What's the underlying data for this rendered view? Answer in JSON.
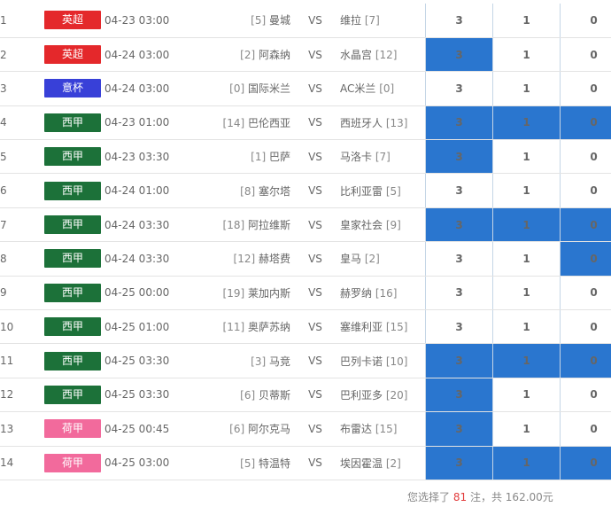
{
  "colors": {
    "selected_bg": "#2a76cf",
    "英超": "#e4282b",
    "意杯": "#3840d8",
    "西甲": "#1c7139",
    "荷甲": "#f26a9c",
    "highlight": "#e23c3c"
  },
  "rows": [
    {
      "num": "1",
      "league": "英超",
      "time": "04-23 03:00",
      "home_rank": "[5]",
      "home": "曼城",
      "vs": "VS",
      "away": "维拉",
      "away_rank": "[7]",
      "odds": [
        {
          "label": "3",
          "selected": false
        },
        {
          "label": "1",
          "selected": false
        },
        {
          "label": "0",
          "selected": false
        }
      ]
    },
    {
      "num": "2",
      "league": "英超",
      "time": "04-24 03:00",
      "home_rank": "[2]",
      "home": "阿森纳",
      "vs": "VS",
      "away": "水晶宫",
      "away_rank": "[12]",
      "odds": [
        {
          "label": "3",
          "selected": true
        },
        {
          "label": "1",
          "selected": false
        },
        {
          "label": "0",
          "selected": false
        }
      ]
    },
    {
      "num": "3",
      "league": "意杯",
      "time": "04-24 03:00",
      "home_rank": "[0]",
      "home": "国际米兰",
      "vs": "VS",
      "away": "AC米兰",
      "away_rank": "[0]",
      "odds": [
        {
          "label": "3",
          "selected": false
        },
        {
          "label": "1",
          "selected": false
        },
        {
          "label": "0",
          "selected": false
        }
      ]
    },
    {
      "num": "4",
      "league": "西甲",
      "time": "04-23 01:00",
      "home_rank": "[14]",
      "home": "巴伦西亚",
      "vs": "VS",
      "away": "西班牙人",
      "away_rank": "[13]",
      "odds": [
        {
          "label": "3",
          "selected": true
        },
        {
          "label": "1",
          "selected": true
        },
        {
          "label": "0",
          "selected": true
        }
      ]
    },
    {
      "num": "5",
      "league": "西甲",
      "time": "04-23 03:30",
      "home_rank": "[1]",
      "home": "巴萨",
      "vs": "VS",
      "away": "马洛卡",
      "away_rank": "[7]",
      "odds": [
        {
          "label": "3",
          "selected": true
        },
        {
          "label": "1",
          "selected": false
        },
        {
          "label": "0",
          "selected": false
        }
      ]
    },
    {
      "num": "6",
      "league": "西甲",
      "time": "04-24 01:00",
      "home_rank": "[8]",
      "home": "塞尔塔",
      "vs": "VS",
      "away": "比利亚雷",
      "away_rank": "[5]",
      "odds": [
        {
          "label": "3",
          "selected": false
        },
        {
          "label": "1",
          "selected": false
        },
        {
          "label": "0",
          "selected": false
        }
      ]
    },
    {
      "num": "7",
      "league": "西甲",
      "time": "04-24 03:30",
      "home_rank": "[18]",
      "home": "阿拉维斯",
      "vs": "VS",
      "away": "皇家社会",
      "away_rank": "[9]",
      "odds": [
        {
          "label": "3",
          "selected": true
        },
        {
          "label": "1",
          "selected": true
        },
        {
          "label": "0",
          "selected": true
        }
      ]
    },
    {
      "num": "8",
      "league": "西甲",
      "time": "04-24 03:30",
      "home_rank": "[12]",
      "home": "赫塔费",
      "vs": "VS",
      "away": "皇马",
      "away_rank": "[2]",
      "odds": [
        {
          "label": "3",
          "selected": false
        },
        {
          "label": "1",
          "selected": false
        },
        {
          "label": "0",
          "selected": true
        }
      ]
    },
    {
      "num": "9",
      "league": "西甲",
      "time": "04-25 00:00",
      "home_rank": "[19]",
      "home": "莱加内斯",
      "vs": "VS",
      "away": "赫罗纳",
      "away_rank": "[16]",
      "odds": [
        {
          "label": "3",
          "selected": false
        },
        {
          "label": "1",
          "selected": false
        },
        {
          "label": "0",
          "selected": false
        }
      ]
    },
    {
      "num": "10",
      "league": "西甲",
      "time": "04-25 01:00",
      "home_rank": "[11]",
      "home": "奥萨苏纳",
      "vs": "VS",
      "away": "塞维利亚",
      "away_rank": "[15]",
      "odds": [
        {
          "label": "3",
          "selected": false
        },
        {
          "label": "1",
          "selected": false
        },
        {
          "label": "0",
          "selected": false
        }
      ]
    },
    {
      "num": "11",
      "league": "西甲",
      "time": "04-25 03:30",
      "home_rank": "[3]",
      "home": "马竞",
      "vs": "VS",
      "away": "巴列卡诺",
      "away_rank": "[10]",
      "odds": [
        {
          "label": "3",
          "selected": true
        },
        {
          "label": "1",
          "selected": true
        },
        {
          "label": "0",
          "selected": true
        }
      ]
    },
    {
      "num": "12",
      "league": "西甲",
      "time": "04-25 03:30",
      "home_rank": "[6]",
      "home": "贝蒂斯",
      "vs": "VS",
      "away": "巴利亚多",
      "away_rank": "[20]",
      "odds": [
        {
          "label": "3",
          "selected": true
        },
        {
          "label": "1",
          "selected": false
        },
        {
          "label": "0",
          "selected": false
        }
      ]
    },
    {
      "num": "13",
      "league": "荷甲",
      "time": "04-25 00:45",
      "home_rank": "[6]",
      "home": "阿尔克马",
      "vs": "VS",
      "away": "布雷达",
      "away_rank": "[15]",
      "odds": [
        {
          "label": "3",
          "selected": true
        },
        {
          "label": "1",
          "selected": false
        },
        {
          "label": "0",
          "selected": false
        }
      ]
    },
    {
      "num": "14",
      "league": "荷甲",
      "time": "04-25 03:00",
      "home_rank": "[5]",
      "home": "特温特",
      "vs": "VS",
      "away": "埃因霍温",
      "away_rank": "[2]",
      "odds": [
        {
          "label": "3",
          "selected": true
        },
        {
          "label": "1",
          "selected": true
        },
        {
          "label": "0",
          "selected": true
        }
      ]
    }
  ],
  "summary": {
    "prefix": "您选择了",
    "count": "81",
    "middle": "注，共",
    "amount": "162.00",
    "suffix": "元"
  }
}
